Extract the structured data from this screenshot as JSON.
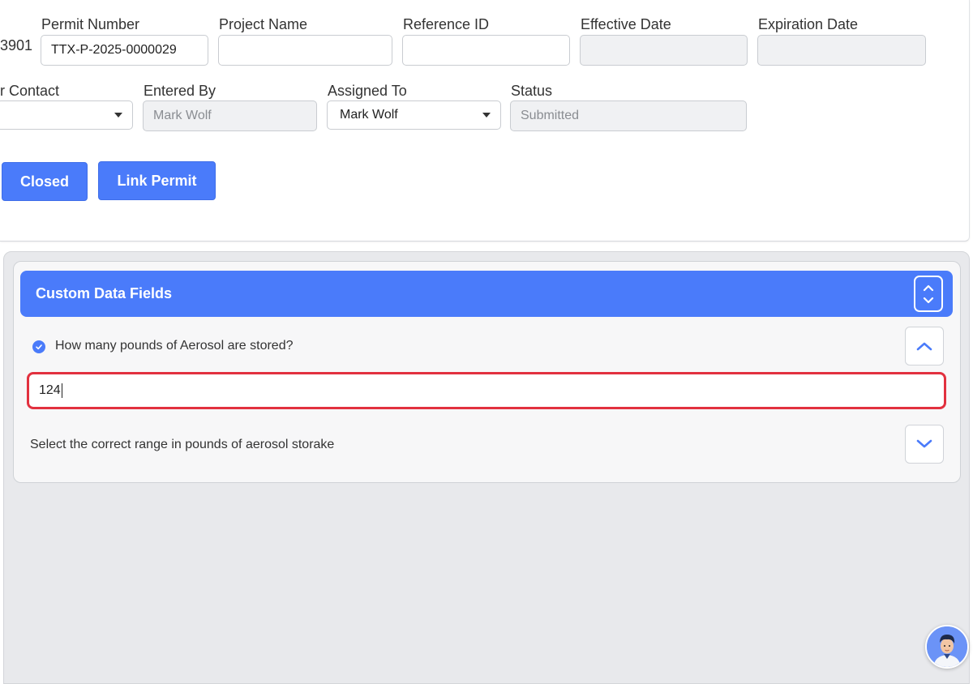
{
  "form": {
    "clipped_left_value": "3901",
    "permit_number": {
      "label": "Permit Number",
      "value": "TTX-P-2025-0000029"
    },
    "project_name": {
      "label": "Project Name",
      "value": ""
    },
    "reference_id": {
      "label": "Reference ID",
      "value": ""
    },
    "effective_date": {
      "label": "Effective Date",
      "value": ""
    },
    "expiration_date": {
      "label": "Expiration Date",
      "value": ""
    },
    "contact": {
      "label": "r Contact",
      "value": ""
    },
    "entered_by": {
      "label": "Entered By",
      "value": "Mark Wolf"
    },
    "assigned_to": {
      "label": "Assigned To",
      "value": "Mark Wolf"
    },
    "status": {
      "label": "Status",
      "value": "Submitted"
    }
  },
  "actions": {
    "closed_label": "Closed",
    "link_permit_label": "Link Permit"
  },
  "custom_fields": {
    "title": "Custom Data Fields",
    "questions": [
      {
        "text": "How many pounds of Aerosol are stored?",
        "answer": "124",
        "expanded": true,
        "answered": true
      },
      {
        "text": "Select the correct range in pounds of aerosol storake",
        "expanded": false,
        "answered": false
      }
    ]
  },
  "colors": {
    "accent": "#4a7bfa",
    "error_border": "#e2313f",
    "panel_bg": "#e8e9ec"
  },
  "icons": {
    "check": "check-circle-icon",
    "chevron_up": "chevron-up-icon",
    "chevron_down": "chevron-down-icon",
    "toggle": "expand-collapse-icon",
    "assistant": "assistant-avatar"
  }
}
